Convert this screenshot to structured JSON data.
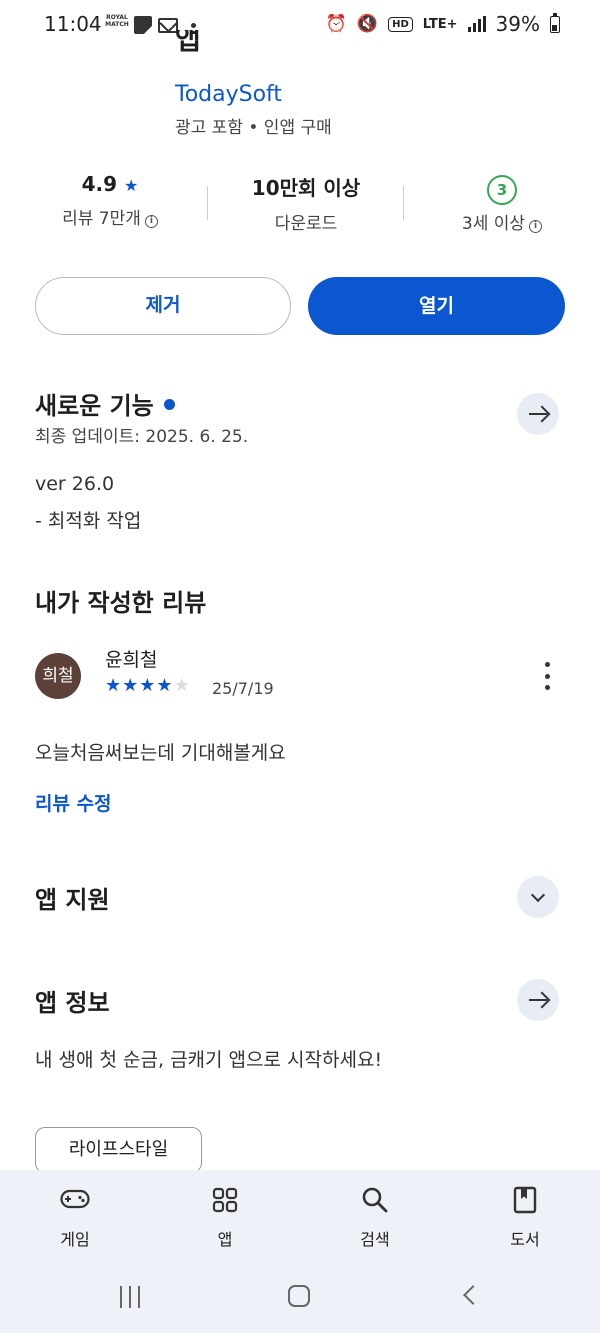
{
  "status_bar": {
    "time": "11:04",
    "royal_text": "ROYAL MATCH",
    "lte": "LTE+",
    "battery": "39%"
  },
  "header": {
    "app_title": "앱",
    "developer": "TodaySoft",
    "meta": "광고 포함 • 인앱 구매"
  },
  "stats": {
    "rating_value": "4.9",
    "rating_label": "리뷰 7만개",
    "downloads_value": "10만회 이상",
    "downloads_label": "다운로드",
    "age_badge": "3",
    "age_label": "3세 이상"
  },
  "actions": {
    "remove_label": "제거",
    "open_label": "열기"
  },
  "whats_new": {
    "title": "새로운 기능",
    "updated": "최종 업데이트: 2025. 6. 25.",
    "version": "ver 26.0",
    "note": "- 최적화 작업"
  },
  "my_review": {
    "title": "내가 작성한 리뷰",
    "avatar_text": "희철",
    "reviewer": "윤희철",
    "rating": 4,
    "date": "25/7/19",
    "text": "오늘처음써보는데 기대해볼게요",
    "edit_label": "리뷰 수정"
  },
  "app_support": {
    "title": "앱 지원"
  },
  "app_info": {
    "title": "앱 정보",
    "description": "내 생애 첫 순금, 금캐기 앱으로 시작하세요!",
    "category_chip": "라이프스타일"
  },
  "bottom_nav": {
    "items": [
      {
        "label": "게임",
        "icon": "gamepad-icon"
      },
      {
        "label": "앱",
        "icon": "apps-grid-icon"
      },
      {
        "label": "검색",
        "icon": "search-icon"
      },
      {
        "label": "도서",
        "icon": "book-icon"
      }
    ]
  },
  "colors": {
    "accent": "#0b57d0",
    "age_badge": "#34a853",
    "avatar_bg": "#5d4037",
    "nav_bg": "#eef1f8"
  }
}
